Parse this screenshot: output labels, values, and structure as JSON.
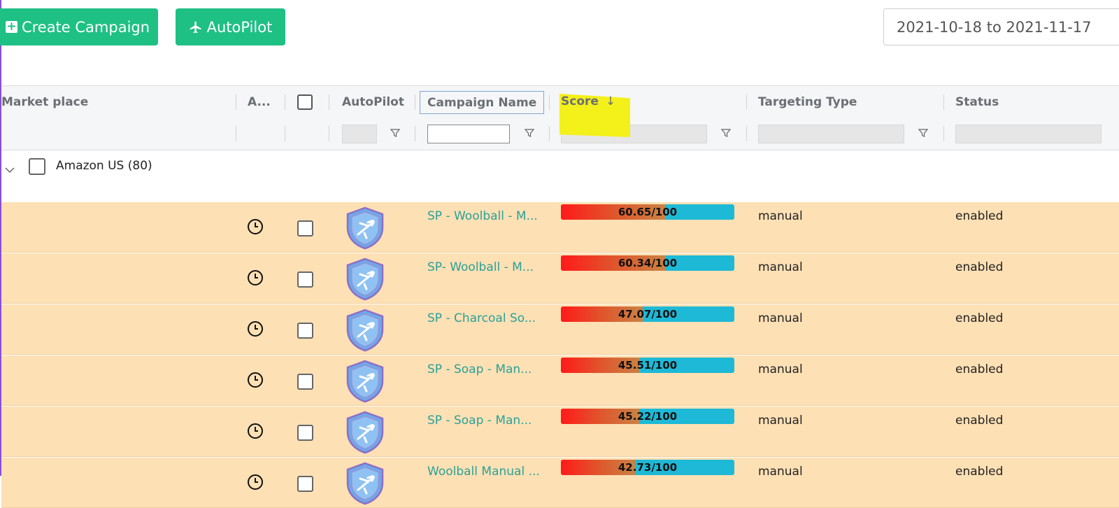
{
  "toolbar": {
    "create_label": "Create Campaign",
    "autopilot_label": "AutoPilot",
    "date_range": "2021-10-18 to 2021-11-17"
  },
  "columns": {
    "marketplace": "Market place",
    "a": "A...",
    "autopilot": "AutoPilot",
    "campaign_name": "Campaign Name",
    "score": "Score",
    "score_sort_icon": "↓",
    "targeting_type": "Targeting Type",
    "status": "Status"
  },
  "group": {
    "label": "Amazon US (80)"
  },
  "rows": [
    {
      "campaign": "SP - Woolball - M...",
      "score_value": 60.65,
      "score_label": "60.65/100",
      "targeting": "manual",
      "status": "enabled"
    },
    {
      "campaign": "SP- Woolball - M...",
      "score_value": 60.34,
      "score_label": "60.34/100",
      "targeting": "manual",
      "status": "enabled"
    },
    {
      "campaign": "SP - Charcoal So...",
      "score_value": 47.07,
      "score_label": "47.07/100",
      "targeting": "manual",
      "status": "enabled"
    },
    {
      "campaign": "SP - Soap - Man...",
      "score_value": 45.51,
      "score_label": "45.51/100",
      "targeting": "manual",
      "status": "enabled"
    },
    {
      "campaign": "SP - Soap - Man...",
      "score_value": 45.22,
      "score_label": "45.22/100",
      "targeting": "manual",
      "status": "enabled"
    },
    {
      "campaign": "Woolball Manual ...",
      "score_value": 42.73,
      "score_label": "42.73/100",
      "targeting": "manual",
      "status": "enabled"
    }
  ],
  "colors": {
    "button_green": "#1ec084",
    "row_highlight": "#fde0b4",
    "link_teal": "#2aa198",
    "score_low": "#ff1a1a",
    "score_remaining": "#1eb9d6",
    "annotation_yellow": "#f4f01a"
  },
  "icons": {
    "create": "plus-square-icon",
    "autopilot": "plane-icon",
    "row_time": "clock-icon",
    "row_autopilot": "shield-plane-icon",
    "filter": "filter-icon",
    "group_toggle": "chevron-down-icon"
  }
}
